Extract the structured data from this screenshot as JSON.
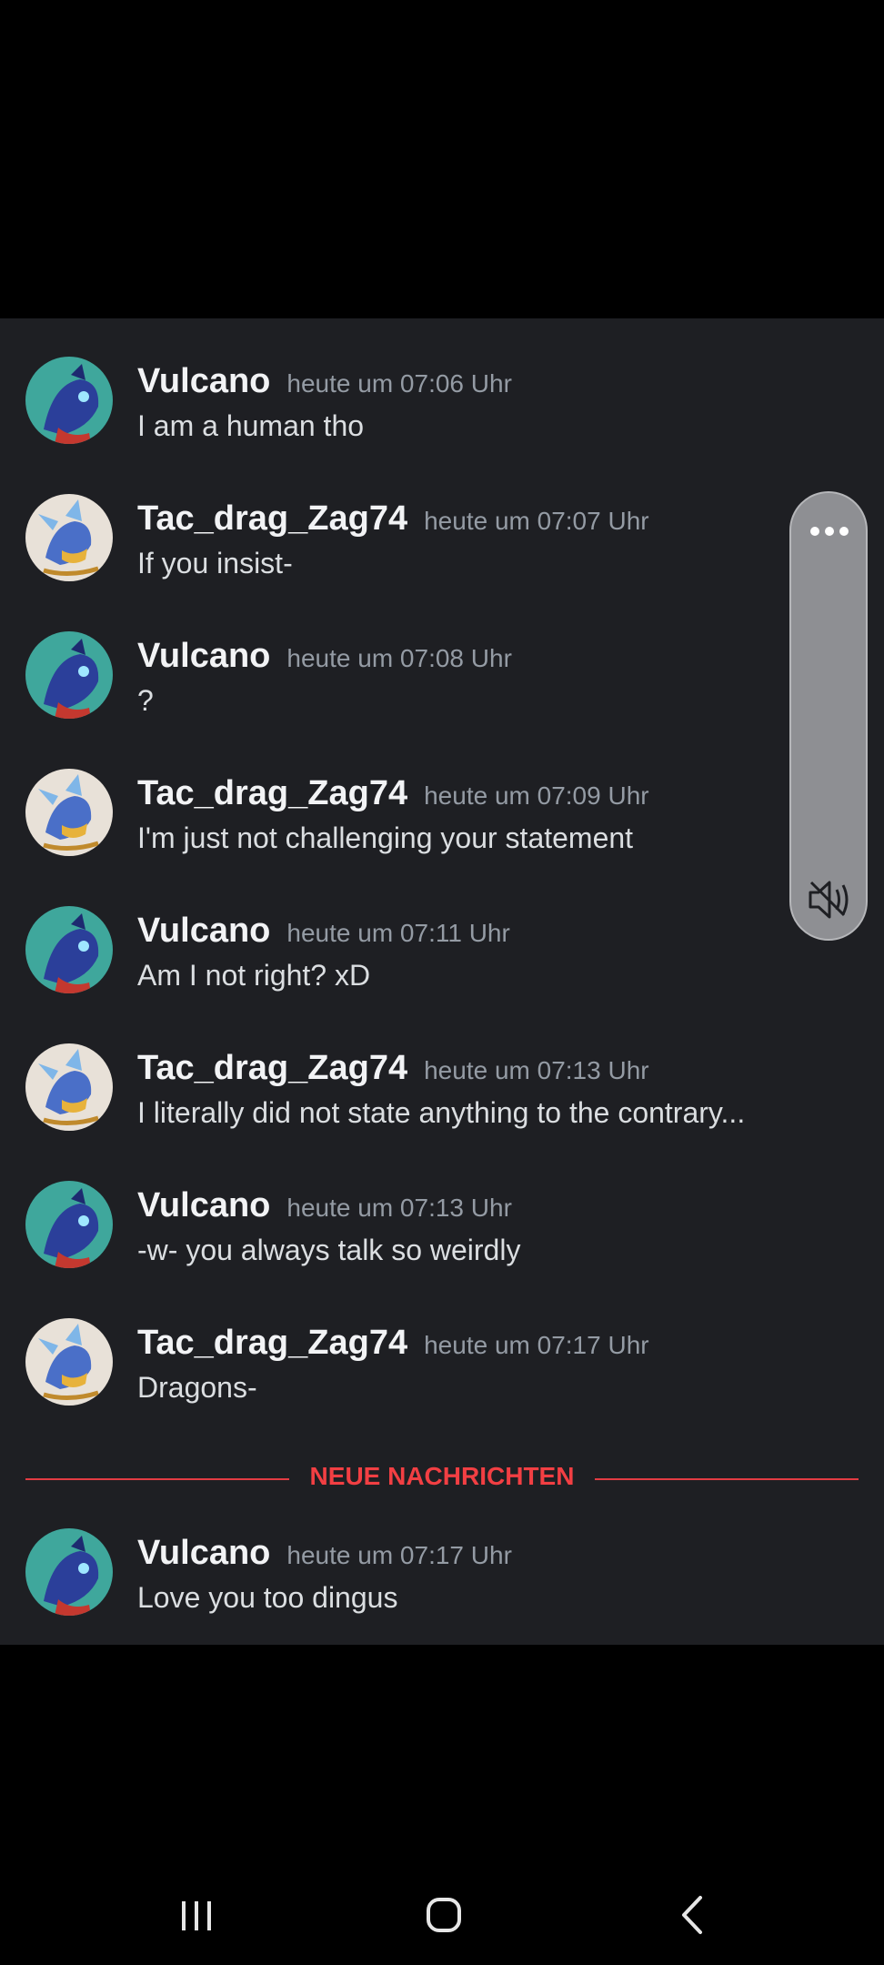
{
  "messages": [
    {
      "author": "Vulcano",
      "time": "heute um 07:06 Uhr",
      "text": "I am a human tho",
      "avatar": "vulcano"
    },
    {
      "author": "Tac_drag_Zag74",
      "time": "heute um 07:07 Uhr",
      "text": "If you insist-",
      "avatar": "tac"
    },
    {
      "author": "Vulcano",
      "time": "heute um 07:08 Uhr",
      "text": "?",
      "avatar": "vulcano"
    },
    {
      "author": "Tac_drag_Zag74",
      "time": "heute um 07:09 Uhr",
      "text": "I'm just not challenging your statement",
      "avatar": "tac"
    },
    {
      "author": "Vulcano",
      "time": "heute um 07:11 Uhr",
      "text": "Am I not right? xD",
      "avatar": "vulcano"
    },
    {
      "author": "Tac_drag_Zag74",
      "time": "heute um 07:13 Uhr",
      "text": "I literally did not state anything to the contrary...",
      "avatar": "tac"
    },
    {
      "author": "Vulcano",
      "time": "heute um 07:13 Uhr",
      "text": "-w- you always talk so weirdly",
      "avatar": "vulcano"
    },
    {
      "author": "Tac_drag_Zag74",
      "time": "heute um 07:17 Uhr",
      "text": "Dragons-",
      "avatar": "tac"
    }
  ],
  "divider": {
    "label": "NEUE NACHRICHTEN",
    "color": "#f23f43"
  },
  "new_messages": [
    {
      "author": "Vulcano",
      "time": "heute um 07:17 Uhr",
      "text": "Love you too dingus",
      "avatar": "vulcano"
    }
  ],
  "float_panel": {
    "icons": [
      "more-icon",
      "mute-icon"
    ]
  },
  "navbar": {
    "icons": [
      "recent-apps-icon",
      "home-icon",
      "back-icon"
    ]
  },
  "colors": {
    "background": "#1e1f23",
    "author": "#f2f3f5",
    "timestamp": "#949ba4",
    "text": "#dbdee1"
  }
}
